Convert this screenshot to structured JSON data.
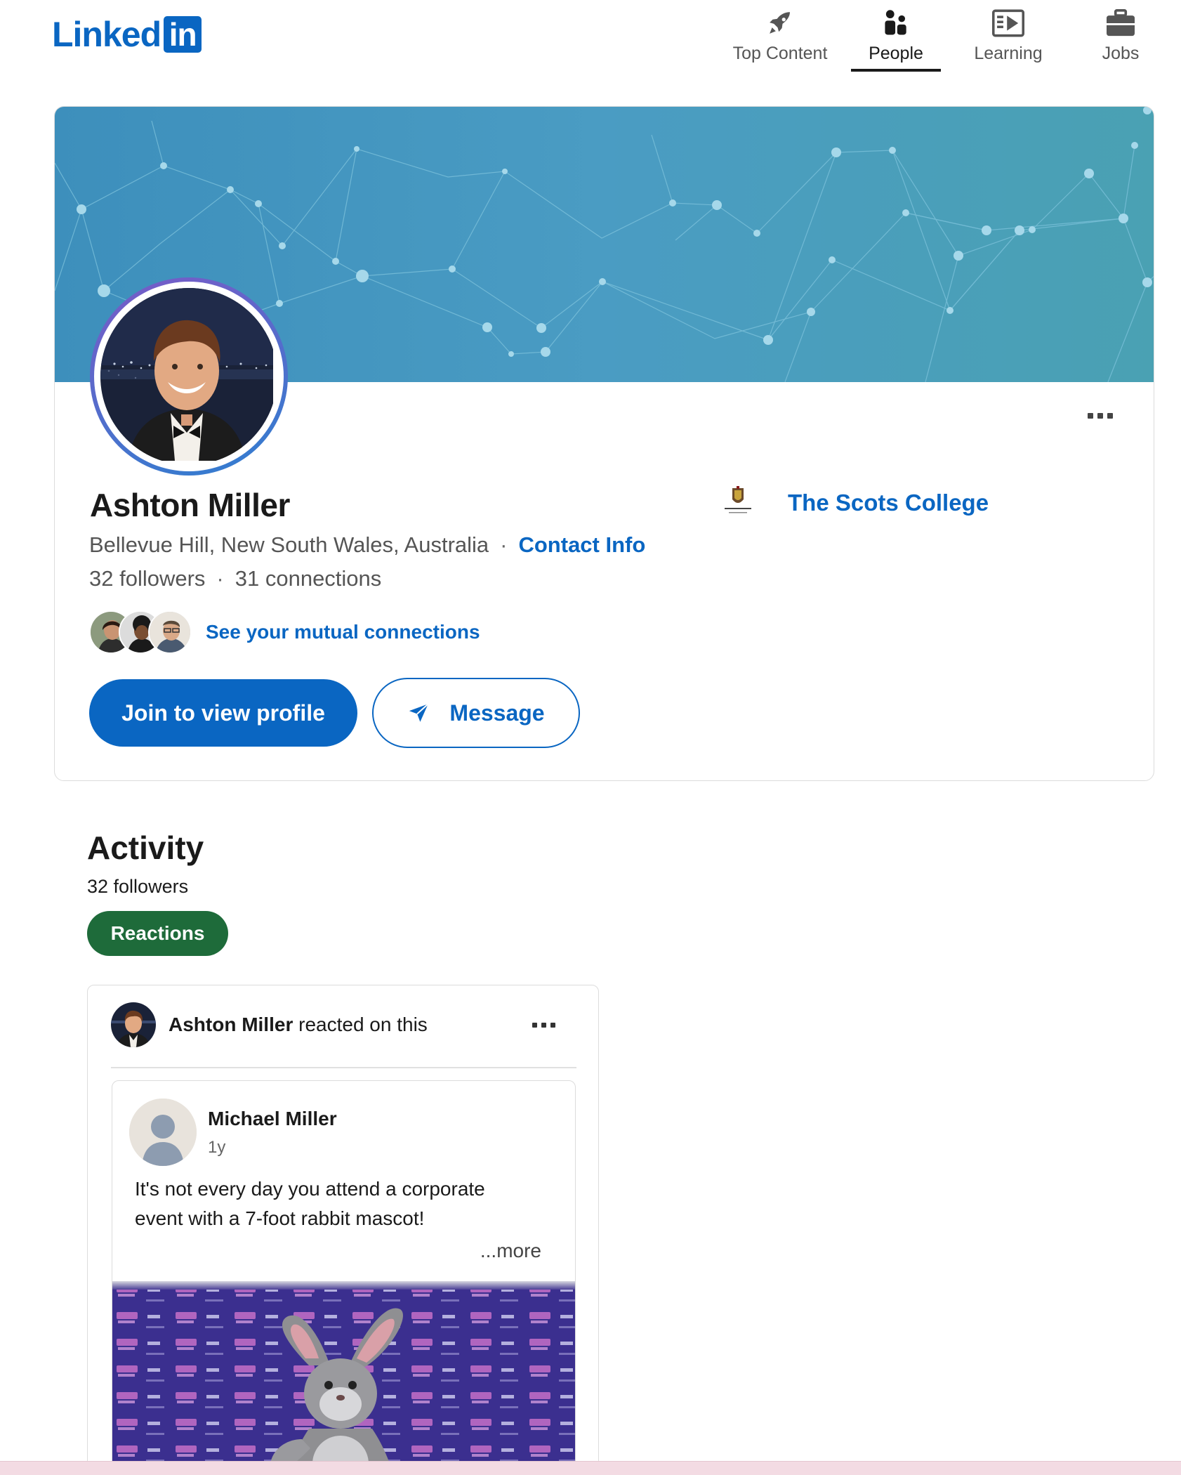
{
  "brand": {
    "logo_text": "Linked",
    "logo_box_text": "in"
  },
  "nav": {
    "items": [
      {
        "label": "Top Content",
        "icon": "rocket-icon"
      },
      {
        "label": "People",
        "icon": "people-icon",
        "active": true
      },
      {
        "label": "Learning",
        "icon": "video-icon"
      },
      {
        "label": "Jobs",
        "icon": "briefcase-icon"
      }
    ]
  },
  "profile": {
    "name": "Ashton Miller",
    "location": "Bellevue Hill, New South Wales, Australia",
    "separator": "·",
    "contact_info_label": "Contact Info",
    "followers": "32 followers",
    "connections": "31 connections",
    "mutual_label": "See your mutual connections",
    "join_button": "Join to view profile",
    "message_button": "Message",
    "school_name": "The Scots College"
  },
  "activity": {
    "title": "Activity",
    "followers": "32 followers",
    "filter_pill": "Reactions",
    "post": {
      "actor_name": "Ashton Miller",
      "actor_action": " reacted on this",
      "author_name": "Michael Miller",
      "time": "1y",
      "text": "It's not every day you attend a corporate event with a 7-foot rabbit mascot!",
      "more_label": "...more"
    }
  },
  "colors": {
    "brand_blue": "#0a66c2",
    "pill_green": "#1e6b3a",
    "banner_teal": "#4a9cc3"
  }
}
